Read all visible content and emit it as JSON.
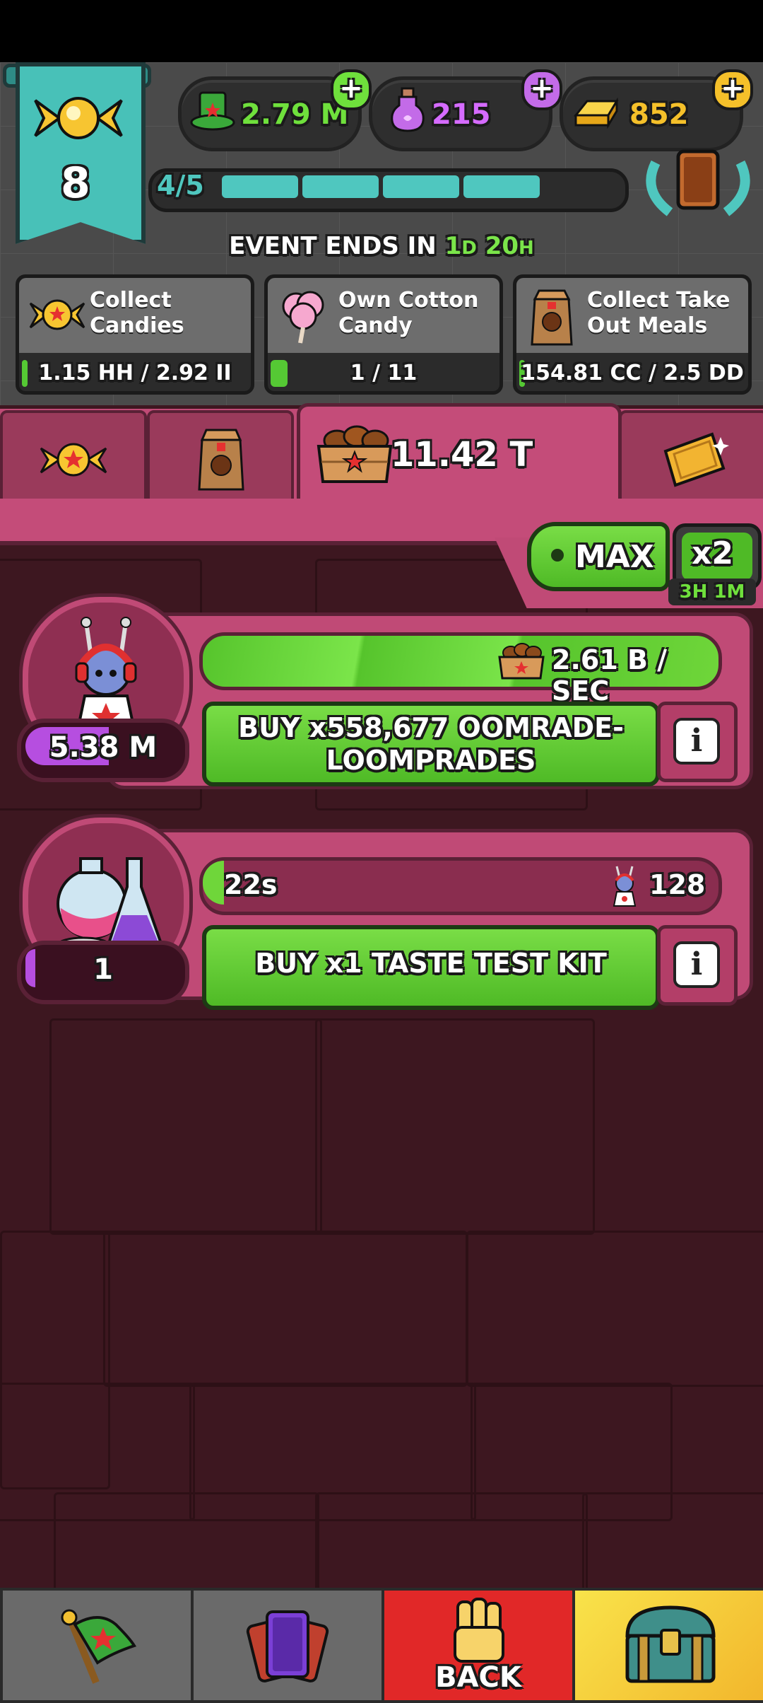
{
  "currencies": {
    "hats": {
      "value": "2.79 M",
      "icon": "green-top-hat-icon",
      "color": "#6fe03c"
    },
    "potions": {
      "value": "215",
      "icon": "purple-potion-bottle-icon",
      "color": "#d56bff"
    },
    "gold": {
      "value": "852",
      "icon": "gold-bar-icon",
      "color": "#f5c02a"
    }
  },
  "level": {
    "value": "8",
    "icon": "candy-icon"
  },
  "progress": {
    "label": "4/5",
    "filled_segments": 4,
    "total_segments": 5
  },
  "event": {
    "prefix": "EVENT ENDS IN",
    "days_num": "1",
    "days_unit": "D",
    "hours_num": "20",
    "hours_unit": "H"
  },
  "quests": [
    {
      "title_line1": "Collect",
      "title_line2": "Candies",
      "progress": "1.15 HH / 2.92 II",
      "icon": "candy-icon",
      "fill": 0.02
    },
    {
      "title_line1": "Own Cotton",
      "title_line2": "Candy",
      "progress": "1 / 11",
      "icon": "cotton-candy-icon",
      "fill": 0.09
    },
    {
      "title_line1": "Collect Take",
      "title_line2": "Out Meals",
      "progress": "154.81 CC / 2.5 DD",
      "icon": "takeout-bag-icon",
      "fill": 0.02
    }
  ],
  "tabs": {
    "active_value": "11.42 T",
    "icons": [
      "candy-icon",
      "takeout-bag-icon",
      "crate-icon",
      "golden-ticket-icon"
    ]
  },
  "multiplier": {
    "max_label": "MAX",
    "boost_label": "x2",
    "boost_timer": "3H 1M"
  },
  "producers": [
    {
      "name": "oompa-loompa",
      "count": "5.38 M",
      "count_fill": 0.55,
      "rate": "2.61 B / SEC",
      "buy_line1": "BUY x558,677 OOMRADE-",
      "buy_line2": "LOOMPRADES",
      "info": "i"
    },
    {
      "name": "taste-test-kit",
      "count": "1",
      "count_fill": 0.05,
      "timer": "22s",
      "required": "128",
      "buy_line1": "BUY x1 TASTE TEST KIT",
      "info": "i"
    }
  ],
  "nav": {
    "back_label": "BACK",
    "items": [
      "flag-icon",
      "cards-icon",
      "back-fist-icon",
      "treasure-chest-icon"
    ]
  }
}
